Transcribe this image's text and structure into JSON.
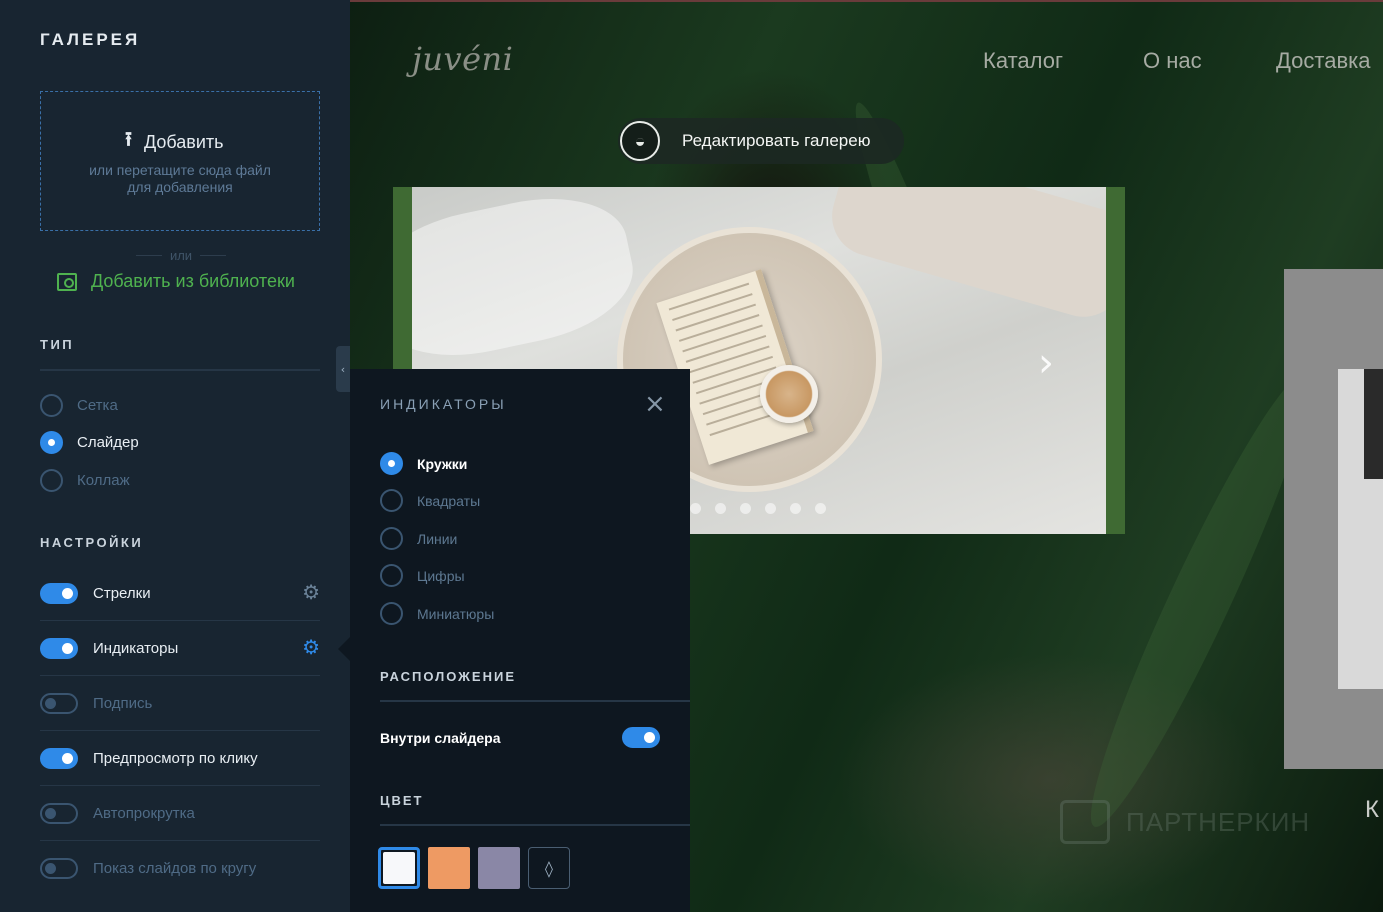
{
  "site": {
    "brand": "juvéni",
    "nav": [
      "Каталог",
      "О нас",
      "Доставка"
    ],
    "edit_gallery_label": "Редактировать галерею",
    "edit_gallery_icon": "image-edit-icon",
    "side_letter": "К",
    "watermark": "ПАРТНЕРКИН",
    "slider": {
      "dots_count": 6,
      "next_icon": "chevron-right-icon"
    }
  },
  "panel": {
    "title": "ГАЛЕРЕЯ",
    "upload": {
      "add_label": "Добавить",
      "hint": "или перетащите сюда файл для добавления",
      "or_label": "или",
      "library_label": "Добавить из библиотеки"
    },
    "type": {
      "label": "ТИП",
      "options": [
        {
          "label": "Сетка",
          "selected": false
        },
        {
          "label": "Слайдер",
          "selected": true
        },
        {
          "label": "Коллаж",
          "selected": false
        }
      ]
    },
    "settings": {
      "label": "НАСТРОЙКИ",
      "items": [
        {
          "label": "Стрелки",
          "on": true,
          "gear": "gray"
        },
        {
          "label": "Индикаторы",
          "on": true,
          "gear": "blue"
        },
        {
          "label": "Подпись",
          "on": false
        },
        {
          "label": "Предпросмотр по клику",
          "on": true
        },
        {
          "label": "Автопрокрутка",
          "on": false
        },
        {
          "label": "Показ слайдов по кругу",
          "on": false
        }
      ]
    }
  },
  "popup": {
    "title": "ИНДИКАТОРЫ",
    "styles": [
      {
        "label": "Кружки",
        "selected": true
      },
      {
        "label": "Квадраты",
        "selected": false
      },
      {
        "label": "Линии",
        "selected": false
      },
      {
        "label": "Цифры",
        "selected": false
      },
      {
        "label": "Миниатюры",
        "selected": false
      }
    ],
    "position_label": "РАСПОЛОЖЕНИЕ",
    "inside_slider_label": "Внутри слайдера",
    "inside_slider_on": true,
    "color_label": "ЦВЕТ",
    "colors": [
      "#f7f8fa",
      "#ee9a63",
      "#8a87a6"
    ],
    "accent": "#2f8ae8"
  }
}
